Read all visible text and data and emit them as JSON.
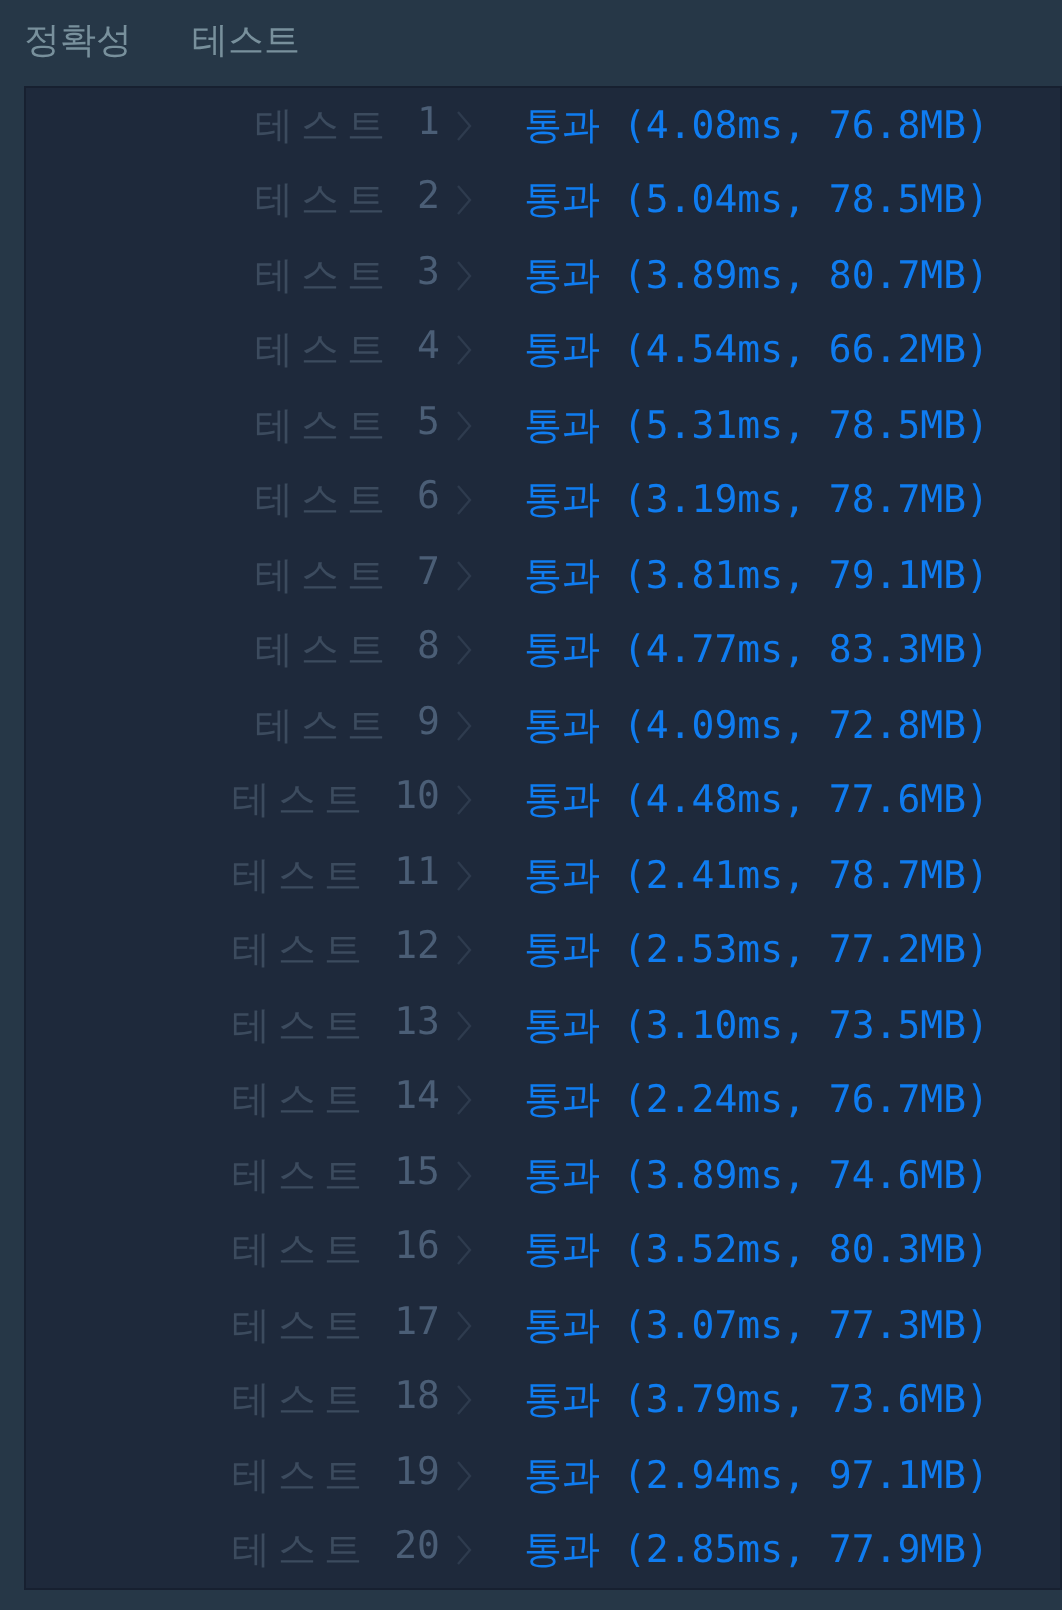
{
  "header": {
    "title": "정확성",
    "subtitle": "테스트"
  },
  "tests": [
    {
      "name": "테스트",
      "number": "1",
      "result": "통과 (4.08ms, 76.8MB)"
    },
    {
      "name": "테스트",
      "number": "2",
      "result": "통과 (5.04ms, 78.5MB)"
    },
    {
      "name": "테스트",
      "number": "3",
      "result": "통과 (3.89ms, 80.7MB)"
    },
    {
      "name": "테스트",
      "number": "4",
      "result": "통과 (4.54ms, 66.2MB)"
    },
    {
      "name": "테스트",
      "number": "5",
      "result": "통과 (5.31ms, 78.5MB)"
    },
    {
      "name": "테스트",
      "number": "6",
      "result": "통과 (3.19ms, 78.7MB)"
    },
    {
      "name": "테스트",
      "number": "7",
      "result": "통과 (3.81ms, 79.1MB)"
    },
    {
      "name": "테스트",
      "number": "8",
      "result": "통과 (4.77ms, 83.3MB)"
    },
    {
      "name": "테스트",
      "number": "9",
      "result": "통과 (4.09ms, 72.8MB)"
    },
    {
      "name": "테스트",
      "number": "10",
      "result": "통과 (4.48ms, 77.6MB)"
    },
    {
      "name": "테스트",
      "number": "11",
      "result": "통과 (2.41ms, 78.7MB)"
    },
    {
      "name": "테스트",
      "number": "12",
      "result": "통과 (2.53ms, 77.2MB)"
    },
    {
      "name": "테스트",
      "number": "13",
      "result": "통과 (3.10ms, 73.5MB)"
    },
    {
      "name": "테스트",
      "number": "14",
      "result": "통과 (2.24ms, 76.7MB)"
    },
    {
      "name": "테스트",
      "number": "15",
      "result": "통과 (3.89ms, 74.6MB)"
    },
    {
      "name": "테스트",
      "number": "16",
      "result": "통과 (3.52ms, 80.3MB)"
    },
    {
      "name": "테스트",
      "number": "17",
      "result": "통과 (3.07ms, 77.3MB)"
    },
    {
      "name": "테스트",
      "number": "18",
      "result": "통과 (3.79ms, 73.6MB)"
    },
    {
      "name": "테스트",
      "number": "19",
      "result": "통과 (2.94ms, 97.1MB)"
    },
    {
      "name": "테스트",
      "number": "20",
      "result": "통과 (2.85ms, 77.9MB)"
    }
  ]
}
